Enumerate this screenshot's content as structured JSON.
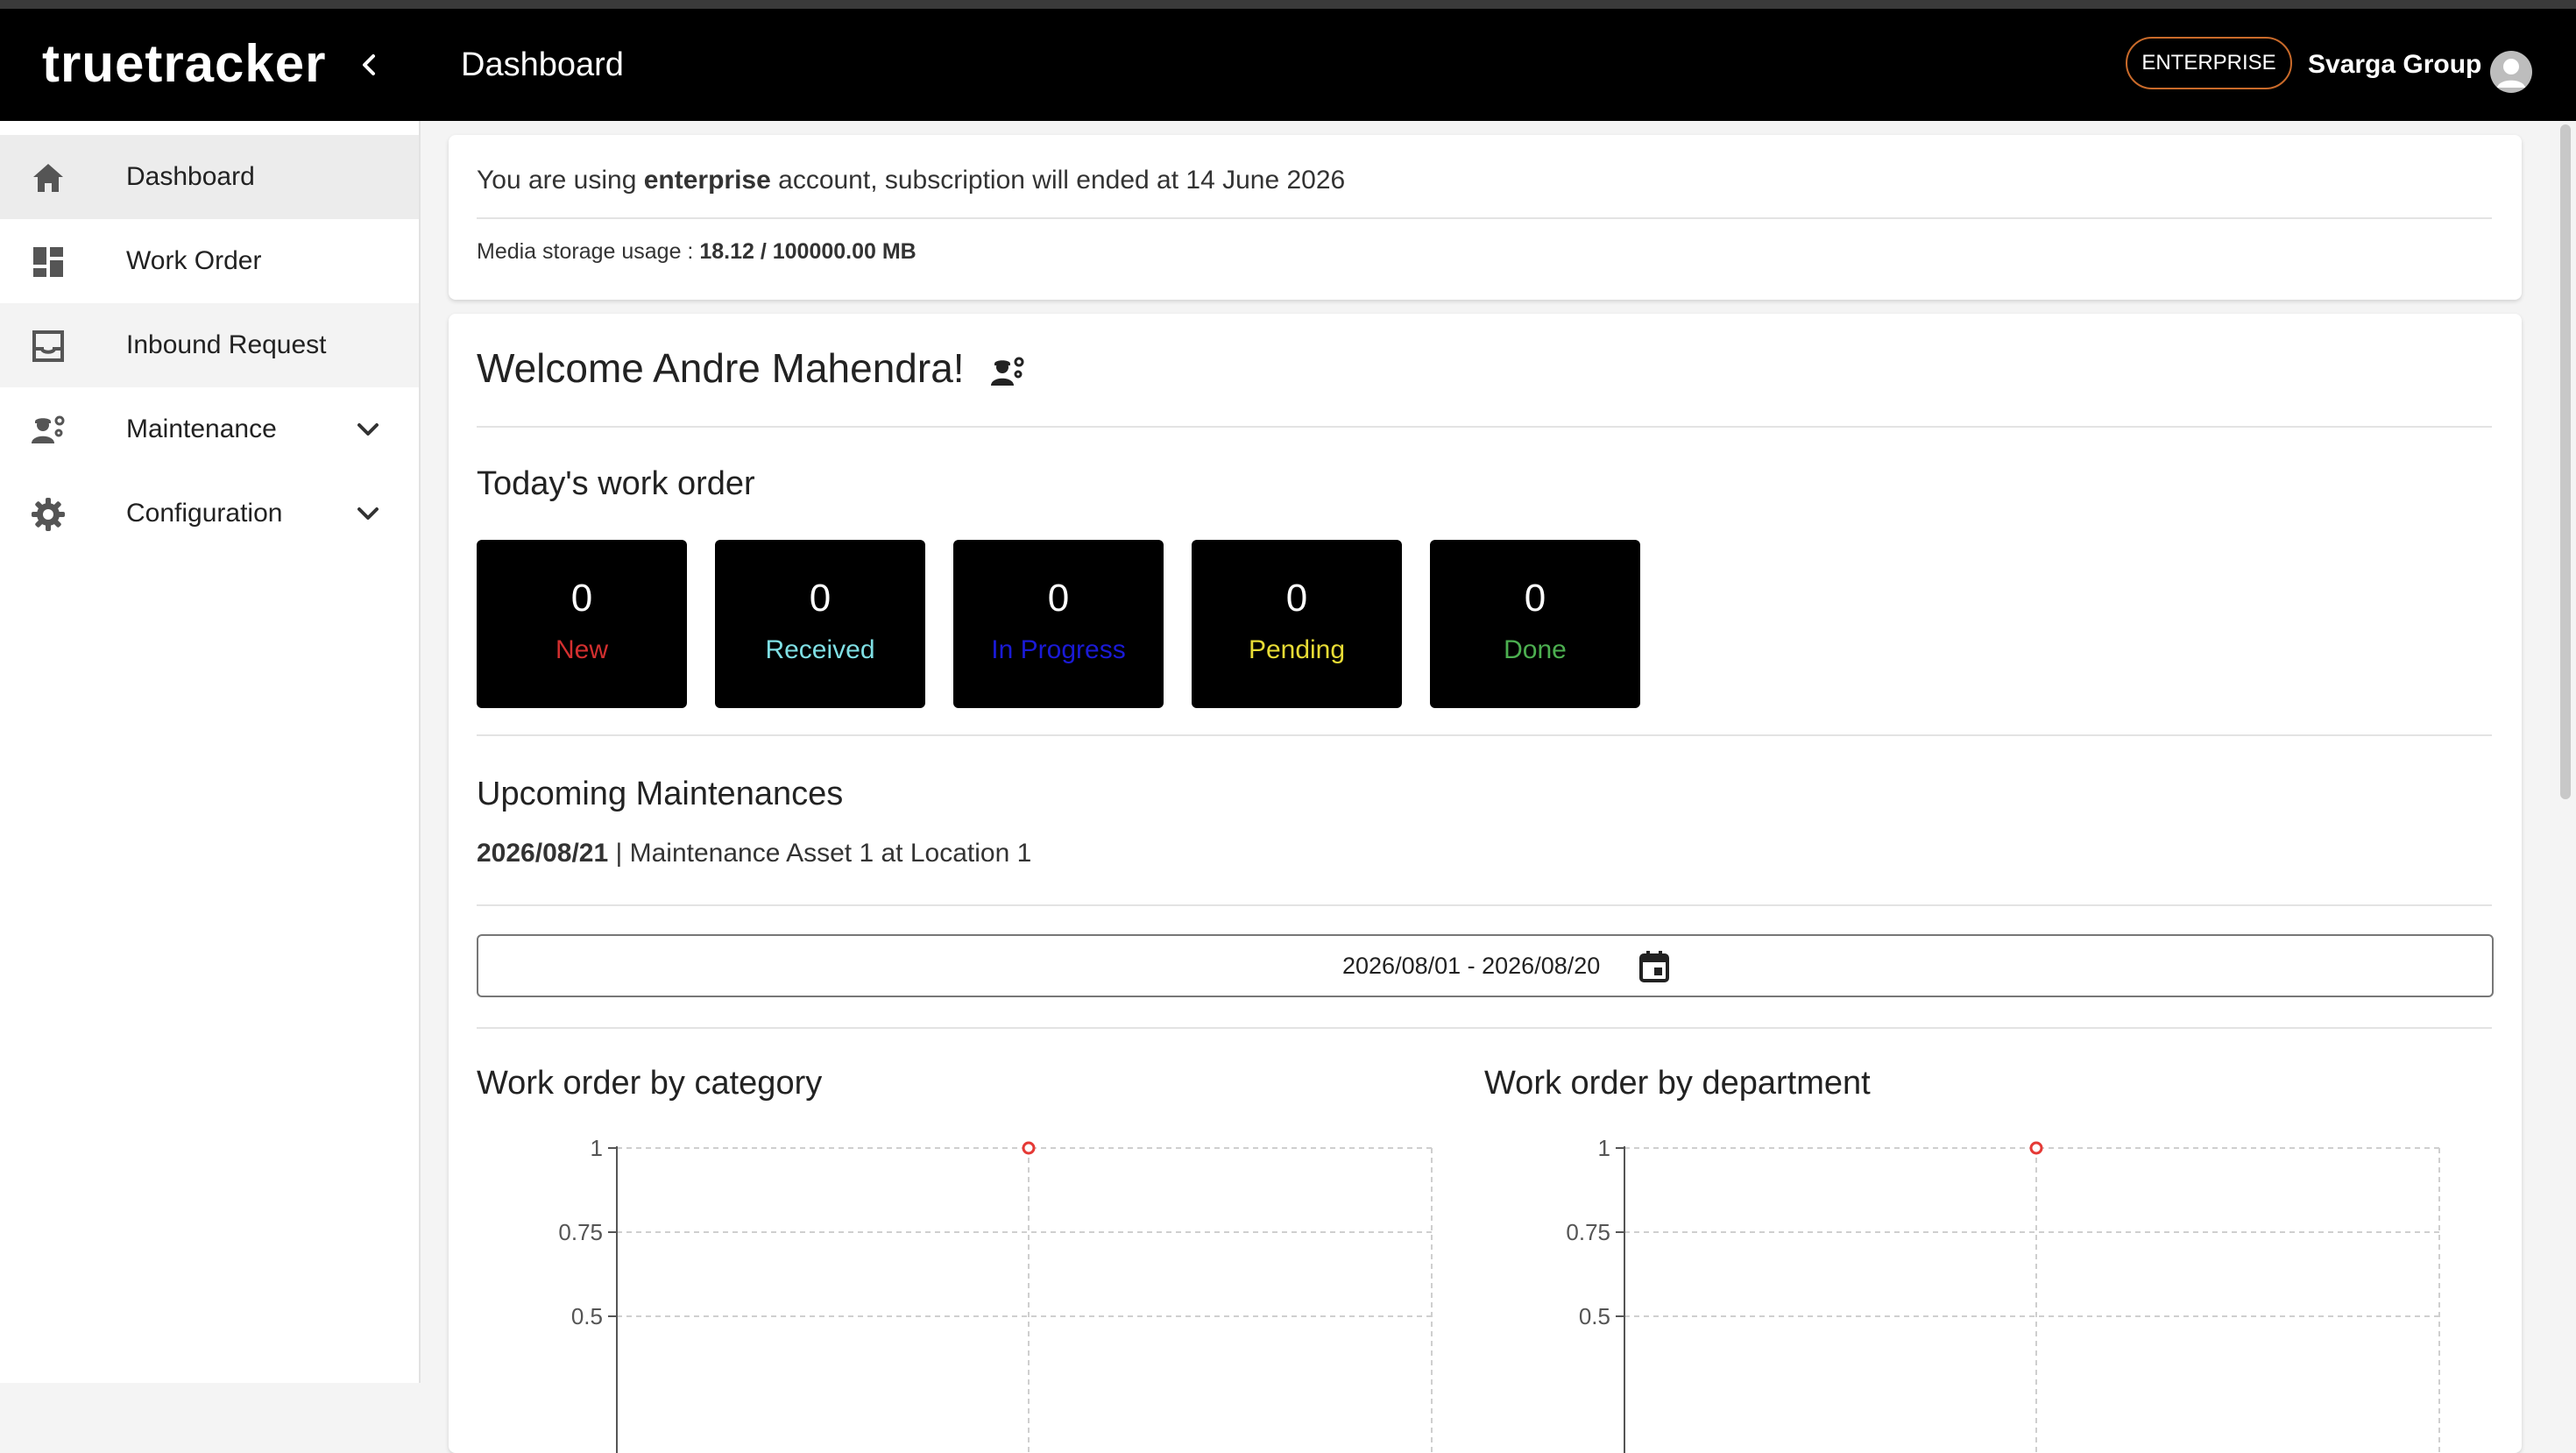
{
  "app": {
    "logo": "truetracker",
    "page_title": "Dashboard",
    "plan_badge": "ENTERPRISE",
    "company_name": "Svarga Group"
  },
  "sidebar": {
    "items": [
      {
        "label": "Dashboard",
        "icon": "home-icon",
        "active": true
      },
      {
        "label": "Work Order",
        "icon": "dashboard-grid-icon"
      },
      {
        "label": "Inbound Request",
        "icon": "inbox-icon"
      },
      {
        "label": "Maintenance",
        "icon": "engineer-icon",
        "expandable": true
      },
      {
        "label": "Configuration",
        "icon": "gear-icon",
        "expandable": true
      }
    ]
  },
  "subscription": {
    "prefix": "You are using ",
    "plan": "enterprise",
    "suffix": " account, subscription will ended at 14 June 2026",
    "storage_label": "Media storage usage : ",
    "storage_value": "18.12 / 100000.00 MB"
  },
  "welcome": {
    "text": "Welcome Andre Mahendra!",
    "icon": "engineer-icon"
  },
  "todays_work_order": {
    "heading": "Today's work order",
    "statuses": [
      {
        "count": "0",
        "label": "New",
        "color": "#d32f2f"
      },
      {
        "count": "0",
        "label": "Received",
        "color": "#7fdfe4"
      },
      {
        "count": "0",
        "label": "In Progress",
        "color": "#1a1ad6"
      },
      {
        "count": "0",
        "label": "Pending",
        "color": "#e8dc35"
      },
      {
        "count": "0",
        "label": "Done",
        "color": "#4caf50"
      }
    ]
  },
  "upcoming": {
    "heading": "Upcoming Maintenances",
    "items": [
      {
        "date": "2026/08/21",
        "separator": " | ",
        "text": "Maintenance Asset 1 at Location 1"
      }
    ]
  },
  "date_filter": {
    "value": "2026/08/01 - 2026/08/20",
    "icon": "calendar-icon"
  },
  "chart_data": [
    {
      "type": "scatter",
      "title": "Work order by category",
      "y_ticks": [
        "1",
        "0.75",
        "0.5"
      ],
      "ylim_visible": [
        0.5,
        1
      ],
      "points": [
        {
          "y": 1
        }
      ],
      "point_color": "#e53935",
      "grid": true
    },
    {
      "type": "scatter",
      "title": "Work order by department",
      "y_ticks": [
        "1",
        "0.75",
        "0.5"
      ],
      "ylim_visible": [
        0.5,
        1
      ],
      "points": [
        {
          "y": 1
        }
      ],
      "point_color": "#e53935",
      "grid": true
    }
  ]
}
